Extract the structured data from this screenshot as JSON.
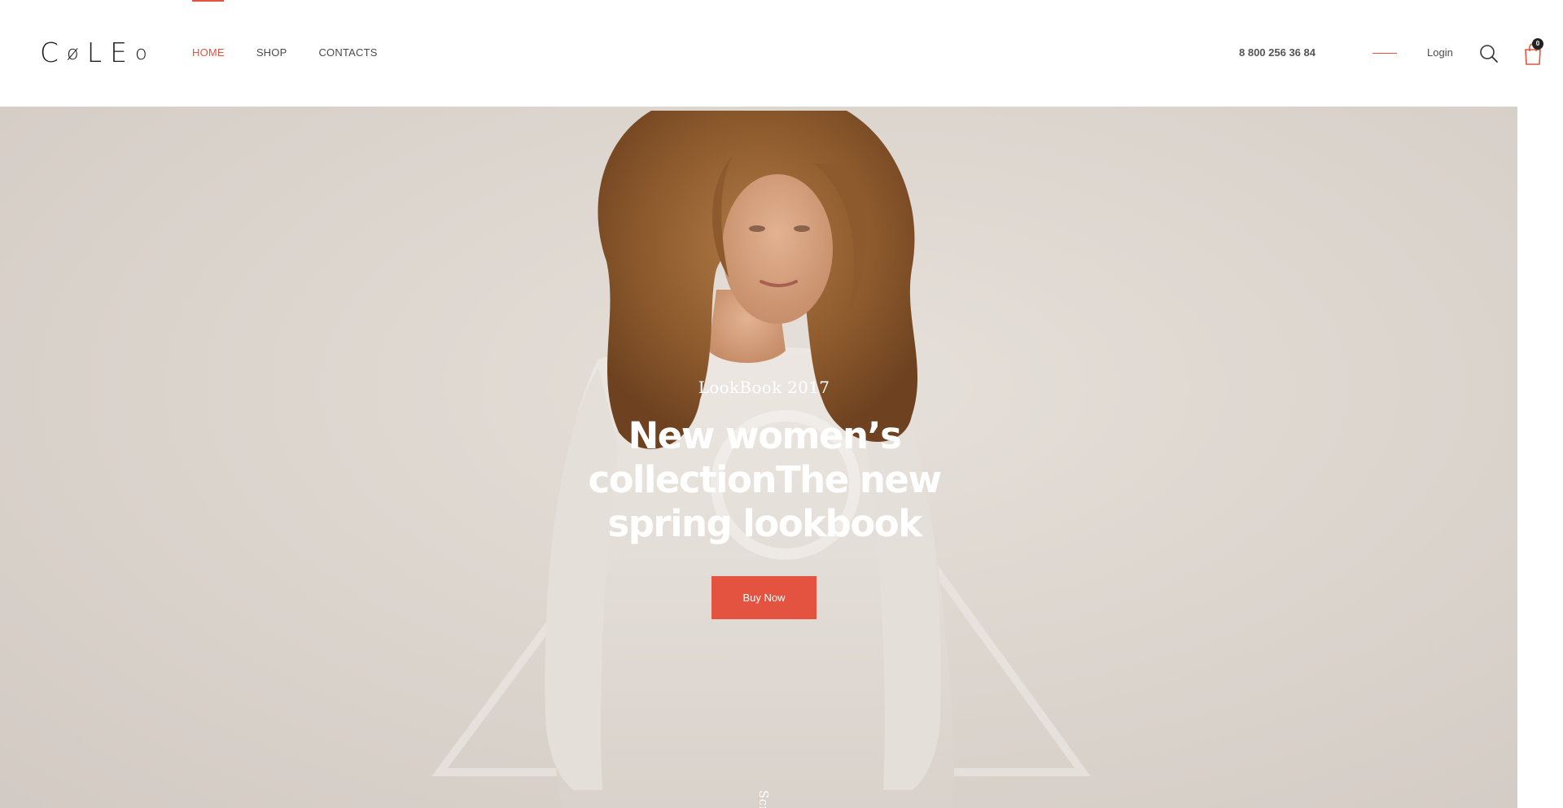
{
  "brand": {
    "logo_letters": [
      "C",
      "ø",
      "L",
      "E",
      "o"
    ]
  },
  "nav": {
    "items": [
      {
        "label": "HOME",
        "active": true
      },
      {
        "label": "SHOP",
        "active": false
      },
      {
        "label": "CONTACTS",
        "active": false
      }
    ]
  },
  "header": {
    "phone": "8 800 256 36 84",
    "login_label": "Login",
    "cart_count": "0"
  },
  "hero": {
    "subtitle": "LookBook 2017",
    "title": "New women’s collectionThe new spring lookbook",
    "button_label": "Buy Now",
    "scroll_label": "Scroll"
  },
  "icons": {
    "search": "search-icon",
    "cart": "shopping-bag-icon"
  },
  "colors": {
    "accent": "#e3533f",
    "text": "#4a4a4a",
    "hero_bg": "#ddd6cf"
  }
}
